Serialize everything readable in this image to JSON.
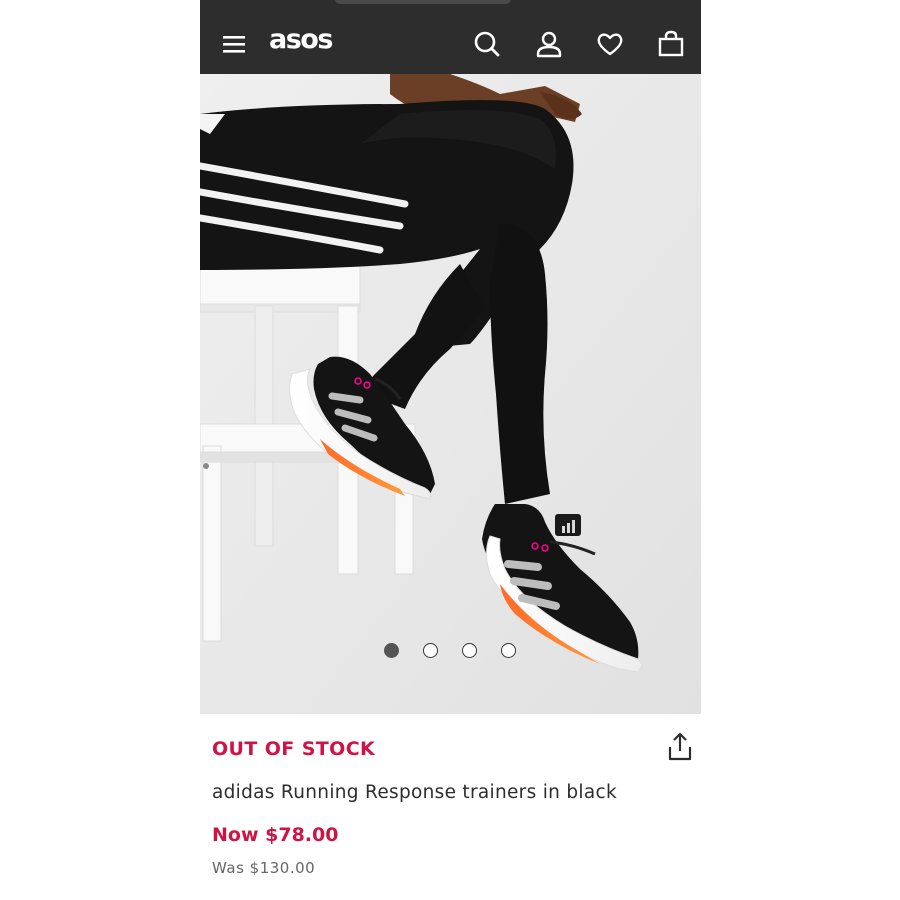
{
  "header": {
    "logo": "asos",
    "icons": [
      "menu-icon",
      "search-icon",
      "account-icon",
      "wishlist-heart-icon",
      "bag-icon"
    ]
  },
  "gallery": {
    "image_count": 4,
    "active_index": 0
  },
  "product": {
    "stock_status": "OUT OF STOCK",
    "title": "adidas Running Response trainers in black",
    "now_price": "Now $78.00",
    "was_price": "Was $130.00"
  },
  "colors": {
    "header_bg": "#2d2d2d",
    "accent_red": "#d01345",
    "text_dark": "#2d2d2d",
    "text_muted": "#666666"
  }
}
